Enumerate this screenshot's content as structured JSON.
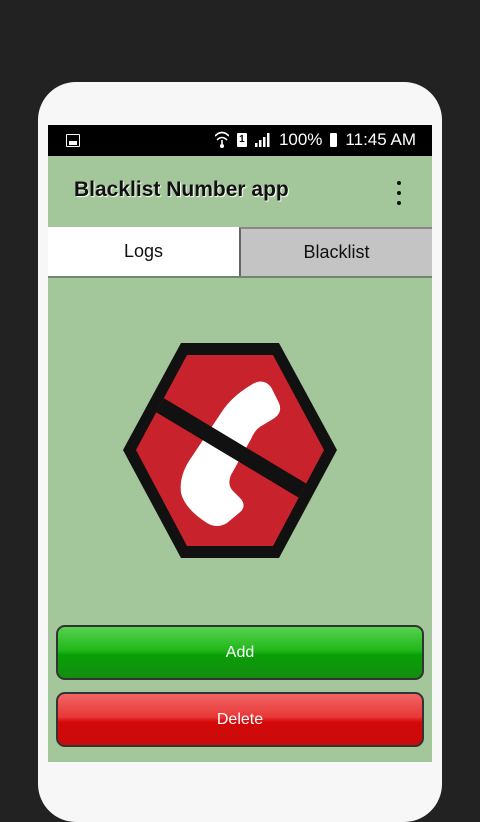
{
  "status_bar": {
    "sim_label": "1",
    "battery": "100%",
    "time": "11:45 AM"
  },
  "app_bar": {
    "title": "Blacklist Number app"
  },
  "tabs": [
    {
      "label": "Logs",
      "active": true
    },
    {
      "label": "Blacklist",
      "active": false
    }
  ],
  "buttons": {
    "add_label": "Add",
    "delete_label": "Delete"
  },
  "colors": {
    "background": "#a3c79a",
    "logo_red": "#c8232c",
    "add_green": "#1aad16",
    "delete_red": "#e01010"
  },
  "icons": {
    "logo": "blocked-phone-icon"
  }
}
